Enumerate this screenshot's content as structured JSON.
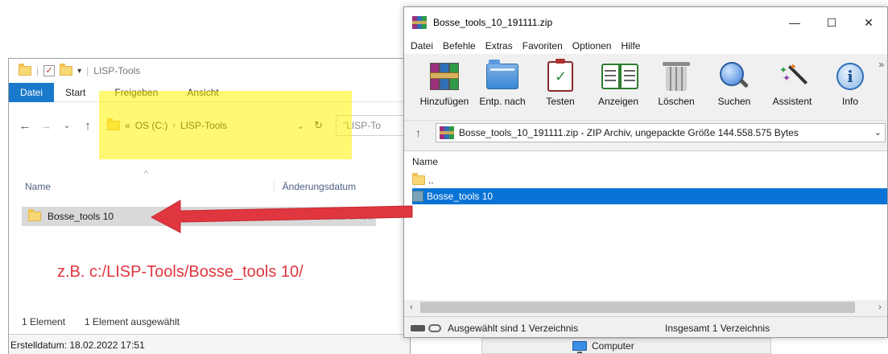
{
  "explorer": {
    "title": "LISP-Tools",
    "ribbon_tabs": [
      "Datei",
      "Start",
      "Freigeben",
      "Ansicht"
    ],
    "address": {
      "prefix": "«",
      "drive": "OS (C:)",
      "separator": "›",
      "folder": "LISP-Tools"
    },
    "search_placeholder": "\"LISP-To",
    "columns": {
      "name": "Name",
      "date": "Änderungsdatum"
    },
    "file": {
      "name": "Bosse_tools 10",
      "date": "18.02.2022 17:51"
    },
    "hint": "z.B. c:/LISP-Tools/Bosse_tools 10/",
    "status_count": "1 Element",
    "status_selected": "1 Element ausgewählt",
    "created": "Erstelldatum: 18.02.2022 17:51"
  },
  "bottom_strip": {
    "label": "Computer"
  },
  "winrar": {
    "title": "Bosse_tools_10_191111.zip",
    "menu": [
      "Datei",
      "Befehle",
      "Extras",
      "Favoriten",
      "Optionen",
      "Hilfe"
    ],
    "toolbar": [
      {
        "label": "Hinzufügen",
        "icon": "add-archive-icon"
      },
      {
        "label": "Entp. nach",
        "icon": "extract-to-icon"
      },
      {
        "label": "Testen",
        "icon": "test-icon"
      },
      {
        "label": "Anzeigen",
        "icon": "view-icon"
      },
      {
        "label": "Löschen",
        "icon": "delete-icon"
      },
      {
        "label": "Suchen",
        "icon": "find-icon"
      },
      {
        "label": "Assistent",
        "icon": "wizard-icon"
      },
      {
        "label": "Info",
        "icon": "info-icon"
      }
    ],
    "path": "Bosse_tools_10_191111.zip - ZIP Archiv, ungepackte Größe 144.558.575 Bytes",
    "list_header": "Name",
    "rows": [
      {
        "name": ".."
      },
      {
        "name": "Bosse_tools 10"
      }
    ],
    "status_left": "Ausgewählt sind 1 Verzeichnis",
    "status_right": "Insgesamt 1 Verzeichnis"
  },
  "colors": {
    "highlight": "#fff200",
    "arrow": "#e0363f",
    "selection": "#0a74d6",
    "ribbon_active": "#1979ca"
  }
}
